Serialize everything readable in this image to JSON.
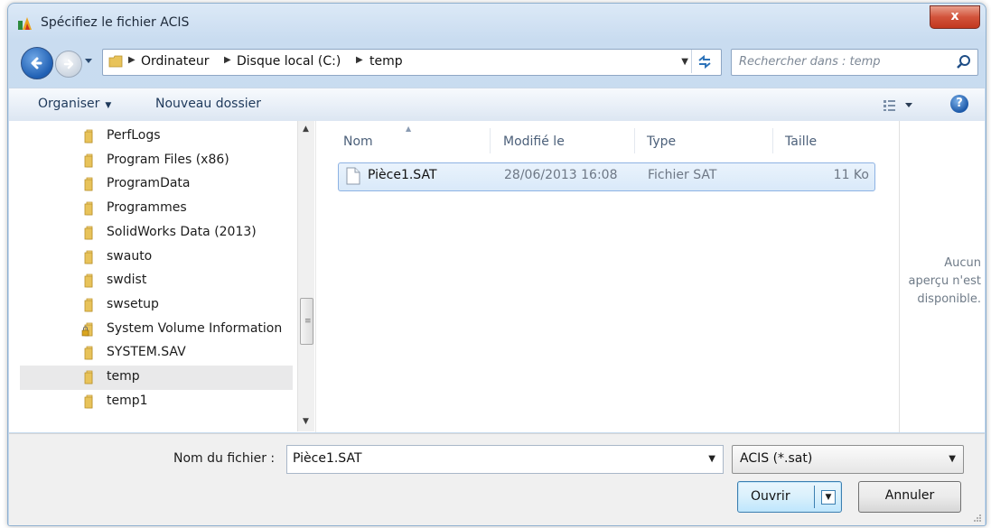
{
  "window": {
    "title": "Spécifiez le fichier ACIS",
    "close_label": "x"
  },
  "nav": {
    "breadcrumb": [
      "Ordinateur",
      "Disque local (C:)",
      "temp"
    ],
    "search_placeholder": "Rechercher dans : temp"
  },
  "toolbar": {
    "organize_label": "Organiser",
    "new_folder_label": "Nouveau dossier",
    "help_label": "?"
  },
  "sidebar": {
    "items": [
      {
        "label": "PerfLogs",
        "locked": false
      },
      {
        "label": "Program Files (x86)",
        "locked": false
      },
      {
        "label": "ProgramData",
        "locked": false
      },
      {
        "label": "Programmes",
        "locked": false
      },
      {
        "label": "SolidWorks Data (2013)",
        "locked": false
      },
      {
        "label": "swauto",
        "locked": false
      },
      {
        "label": "swdist",
        "locked": false
      },
      {
        "label": "swsetup",
        "locked": false
      },
      {
        "label": "System Volume Information",
        "locked": true
      },
      {
        "label": "SYSTEM.SAV",
        "locked": false
      },
      {
        "label": "temp",
        "locked": false,
        "selected": true
      },
      {
        "label": "temp1",
        "locked": false
      }
    ]
  },
  "file_list": {
    "columns": [
      "Nom",
      "Modifié le",
      "Type",
      "Taille"
    ],
    "rows": [
      {
        "name": "Pièce1.SAT",
        "modified": "28/06/2013 16:08",
        "type": "Fichier SAT",
        "size": "11 Ko"
      }
    ]
  },
  "preview": {
    "line1": "Aucun",
    "line2": "aperçu n'est",
    "line3": "disponible."
  },
  "bottom": {
    "filename_label": "Nom du fichier :",
    "filename_value": "Pièce1.SAT",
    "filetype_value": "ACIS (*.sat)",
    "open_label": "Ouvrir",
    "cancel_label": "Annuler"
  },
  "colors": {
    "selection_fill": "#d9e9f9",
    "selection_border": "#8db2e3",
    "header_text": "#4c607a",
    "folder_yellow": "#e8c35a"
  }
}
